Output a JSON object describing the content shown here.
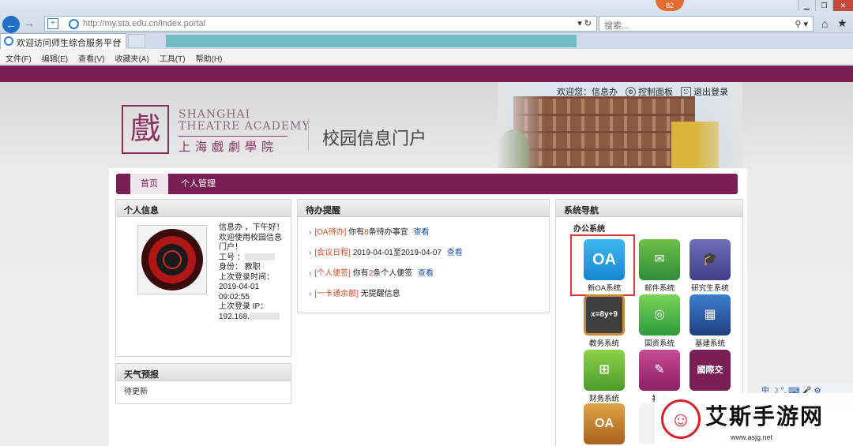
{
  "browser": {
    "address": "http://my.sta.edu.cn/index.portal",
    "search_placeholder": "搜索...",
    "tab_title": "欢迎访问师生综合服务平台",
    "badge_count": "82",
    "menu": [
      "文件(F)",
      "编辑(E)",
      "查看(V)",
      "收藏夹(A)",
      "工具(T)",
      "帮助(H)"
    ]
  },
  "header": {
    "logo_en_1": "SHANGHAI",
    "logo_en_2": "THEATRE ACADEMY",
    "logo_cn": "上海戲劇學院",
    "portal_title": "校园信息门户",
    "welcome": "欢迎您：信息办",
    "control_panel": "控制面板",
    "logout": "退出登录"
  },
  "nav": {
    "home": "首页",
    "personal": "个人管理"
  },
  "personal_info": {
    "title": "个人信息",
    "greeting": "信息办 ，下午好！",
    "welcome_line": "欢迎使用校园信息门户！",
    "id_label": "工号 ：",
    "role_line": "身份： 教职",
    "last_login_time_label": "上次登录时间：",
    "last_login_time": "2019-04-01 09:02:55",
    "last_login_ip_label": "上次登录 IP：",
    "last_login_ip": "192.168."
  },
  "weather": {
    "title": "天气预报",
    "text": "待更新"
  },
  "todo": {
    "title": "待办提醒",
    "items": [
      {
        "tag": "[OA待办]",
        "pre": "你有",
        "num": "8",
        "post": "条待办事宜",
        "link": "查看"
      },
      {
        "tag": "[会议日程]",
        "pre": "2019-04-01至2019-04-07",
        "num": "",
        "post": "",
        "link": "查看"
      },
      {
        "tag": "[个人便签]",
        "pre": "你有",
        "num": "2",
        "post": "条个人便签",
        "link": "查看"
      },
      {
        "tag": "[一卡通余额]",
        "pre": "无提醒信息",
        "num": "",
        "post": "",
        "link": ""
      }
    ]
  },
  "system_nav": {
    "title": "系统导航",
    "subtitle": "办公系统",
    "tiles": [
      {
        "label": "新OA系统",
        "text": "OA"
      },
      {
        "label": "邮件系统",
        "text": ""
      },
      {
        "label": "研究生系统",
        "text": ""
      },
      {
        "label": "教务系统",
        "text": "x=8y+9"
      },
      {
        "label": "国资系统",
        "text": ""
      },
      {
        "label": "基建系统",
        "text": ""
      },
      {
        "label": "财务系统",
        "text": ""
      },
      {
        "label": "教学",
        "text": ""
      },
      {
        "label": "",
        "text": "國際交"
      },
      {
        "label": "",
        "text": "OA"
      },
      {
        "label": "",
        "text": ""
      }
    ]
  },
  "ime": "中 ☽ °, ⌨ 🎤 ⚙",
  "watermark": {
    "title": "艾斯手游网",
    "url": "www.asjg.net"
  },
  "colors": {
    "brand": "#7a1f55",
    "highlight": "#d83a3a",
    "link": "#1f4fa3",
    "accent_red": "#d84a2a"
  }
}
